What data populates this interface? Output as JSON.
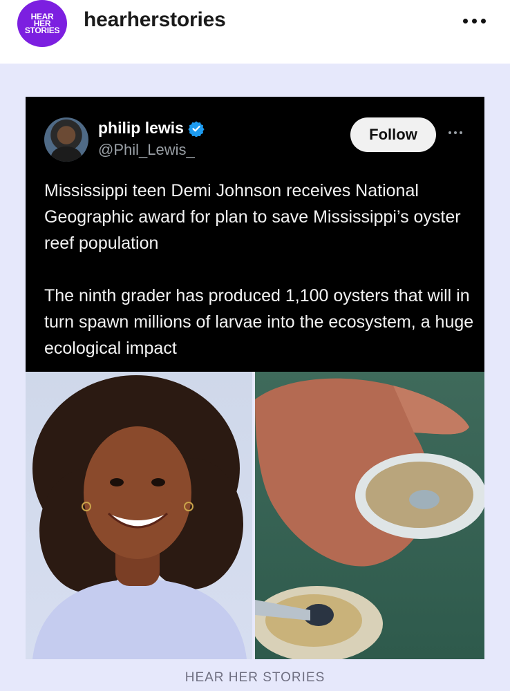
{
  "header": {
    "avatar_logo_text": "HEAR\nHER\nSTORIES",
    "username": "hearherstories",
    "more_icon": "more-horizontal-icon"
  },
  "tweet": {
    "author_name": "philip lewis",
    "author_handle": "@Phil_Lewis_",
    "verified_icon": "verified-badge-icon",
    "verified_color": "#1d9bf0",
    "follow_label": "Follow",
    "paragraphs": [
      "Mississippi teen Demi Johnson receives National Geographic award for plan to save Mississippi’s oyster reef population",
      "The ninth grader has produced 1,100 oysters that will in turn spawn millions of larvae into the ecosystem, a huge ecological impact"
    ]
  },
  "images": {
    "left": "portrait-photo",
    "right": "oyster-in-hand-photo"
  },
  "footer": {
    "label": "HEAR HER STORIES"
  },
  "colors": {
    "brand_purple": "#7c1fe0",
    "canvas": "#e6e8fb",
    "tweet_bg": "#000000"
  }
}
